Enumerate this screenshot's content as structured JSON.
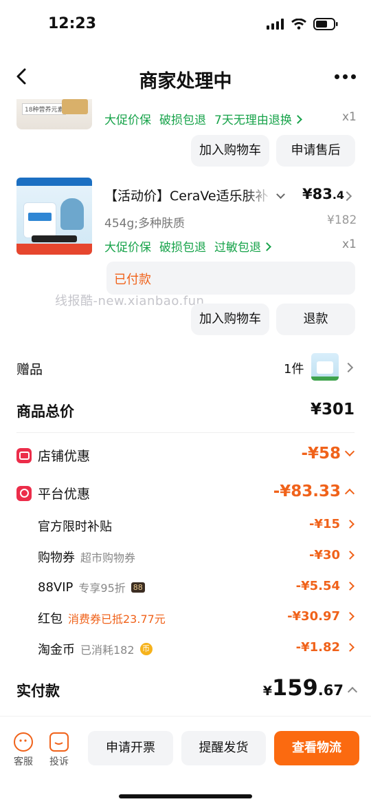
{
  "status_bar": {
    "time": "12:23"
  },
  "nav": {
    "title": "商家处理中"
  },
  "item1": {
    "thumb_tag": "18种营养元素",
    "tags": [
      "大促价保",
      "破损包退",
      "7天无理由退换"
    ],
    "qty": "x1",
    "buttons": {
      "add_cart": "加入购物车",
      "after_sale": "申请售后"
    }
  },
  "item2": {
    "title": "【活动价】CeraVe适乐肤补",
    "price_int": "¥83",
    "price_dec": ".4",
    "spec": "454g;多种肤质",
    "orig_price": "¥182",
    "tags": [
      "大促价保",
      "破损包退",
      "过敏包退"
    ],
    "qty": "x1",
    "status": "已付款",
    "buttons": {
      "add_cart": "加入购物车",
      "refund": "退款"
    }
  },
  "watermark": "线报酷-new.xianbao.fun",
  "gift": {
    "label": "赠品",
    "count": "1件"
  },
  "summary": {
    "total_label": "商品总价",
    "total_value": "¥301",
    "store_discount_label": "店铺优惠",
    "store_discount_value": "-¥58",
    "platform_discount_label": "平台优惠",
    "platform_discount_value": "-¥83.33",
    "details": [
      {
        "label": "官方限时补贴",
        "note": "",
        "value": "-¥15"
      },
      {
        "label": "购物券",
        "note": "超市购物券",
        "value": "-¥30"
      },
      {
        "label": "88VIP",
        "note": "专享95折",
        "badge": "88",
        "value": "-¥5.54"
      },
      {
        "label": "红包",
        "note": "消费券已抵23.77元",
        "value": "-¥30.97"
      },
      {
        "label": "淘金币",
        "note": "已消耗182",
        "badge": "币",
        "value": "-¥1.82"
      }
    ],
    "paid_label": "实付款",
    "paid_currency": "¥",
    "paid_int": "159",
    "paid_dec": ".67"
  },
  "bottom": {
    "service": "客服",
    "complaint": "投诉",
    "invoice": "申请开票",
    "remind": "提醒发货",
    "logistics": "查看物流"
  },
  "colors": {
    "accent_orange": "#f0621a",
    "primary_button": "#fb6a10",
    "tag_green": "#17a34a",
    "badge_red": "#ec2d4a"
  }
}
